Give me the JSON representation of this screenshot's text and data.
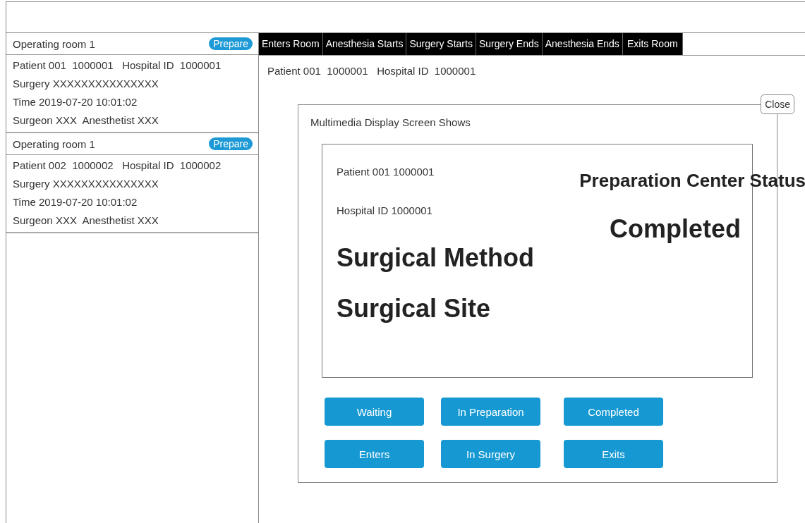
{
  "rooms": [
    {
      "title": "Operating room 1",
      "badge": "Prepare",
      "lines": [
        "Patient 001  1000001   Hospital ID  1000001",
        "Surgery XXXXXXXXXXXXXXX",
        "Time 2019-07-20 10:01:02",
        "Surgeon XXX  Anesthetist XXX"
      ]
    },
    {
      "title": "Operating room 1",
      "badge": "Prepare",
      "lines": [
        "Patient 002  1000002   Hospital ID  1000002",
        "Surgery XXXXXXXXXXXXXXX",
        "Time 2019-07-20 10:01:02",
        "Surgeon XXX  Anesthetist XXX"
      ]
    }
  ],
  "tabs": [
    "Enters Room",
    "Anesthesia Starts",
    "Surgery Starts",
    "Surgery Ends",
    "Anesthesia Ends",
    "Exits Room"
  ],
  "patient_line": "Patient 001  1000001   Hospital ID  1000001",
  "dialog": {
    "title": "Multimedia Display Screen Shows",
    "close": "Close",
    "screen": {
      "patient": "Patient 001 1000001",
      "hospital_id": "Hospital ID 1000001",
      "method": "Surgical Method",
      "site": "Surgical Site",
      "status_title": "Preparation Center Status",
      "status": "Completed"
    },
    "buttons": [
      [
        "Waiting",
        "In Preparation",
        "Completed"
      ],
      [
        "Enters",
        "In Surgery",
        "Exits"
      ]
    ]
  }
}
